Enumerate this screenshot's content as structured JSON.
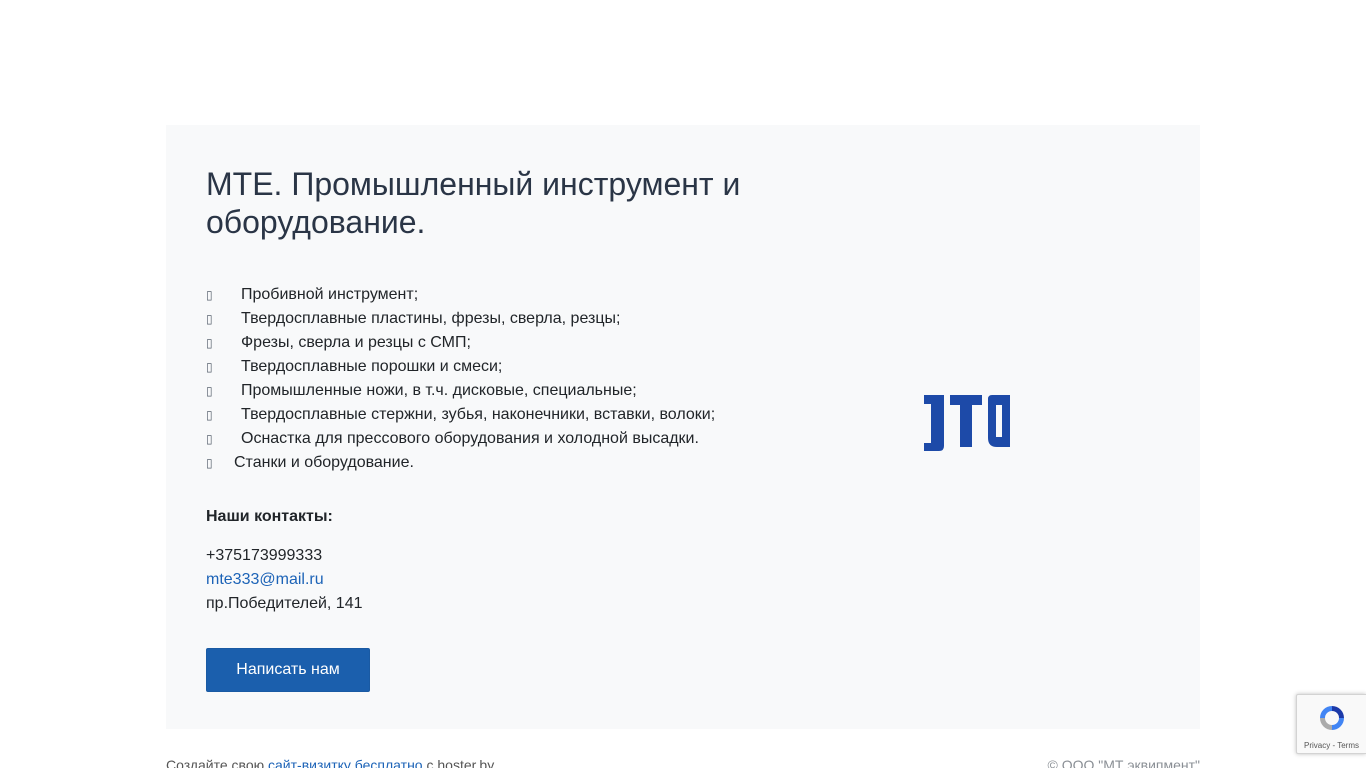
{
  "main": {
    "title": "МТЕ. Промышленный инструмент и оборудование.",
    "features": [
      "Пробивной инструмент;",
      "Твердосплавные пластины, фрезы, сверла, резцы;",
      "Фрезы, сверла и резцы с СМП;",
      "Твердосплавные порошки и смеси;",
      "Промышленные ножи, в т.ч. дисковые, специальные;",
      "Твердосплавные стержни, зубья, наконечники, вставки, волоки;",
      "Оснастка для прессового оборудования и холодной высадки.",
      "Станки и оборудование."
    ],
    "contacts_heading": "Наши контакты:",
    "phone": "+375173999333",
    "email": "mte333@mail.ru",
    "address": "пр.Победителей, 141",
    "button_label": "Написать нам"
  },
  "logo": {
    "icon": "mte-logo-icon",
    "color": "#1d4aa8"
  },
  "footer": {
    "prefix": "Создайте свою",
    "link": "сайт-визитку бесплатно",
    "suffix": "с hoster.by",
    "copyright": "© ООО \"МТ эквипмент\""
  },
  "recaptcha": {
    "links": "Privacy - Terms"
  },
  "colors": {
    "card_bg": "#f8f9fa",
    "button_bg": "#1b5fad",
    "link": "#1c63b7"
  }
}
